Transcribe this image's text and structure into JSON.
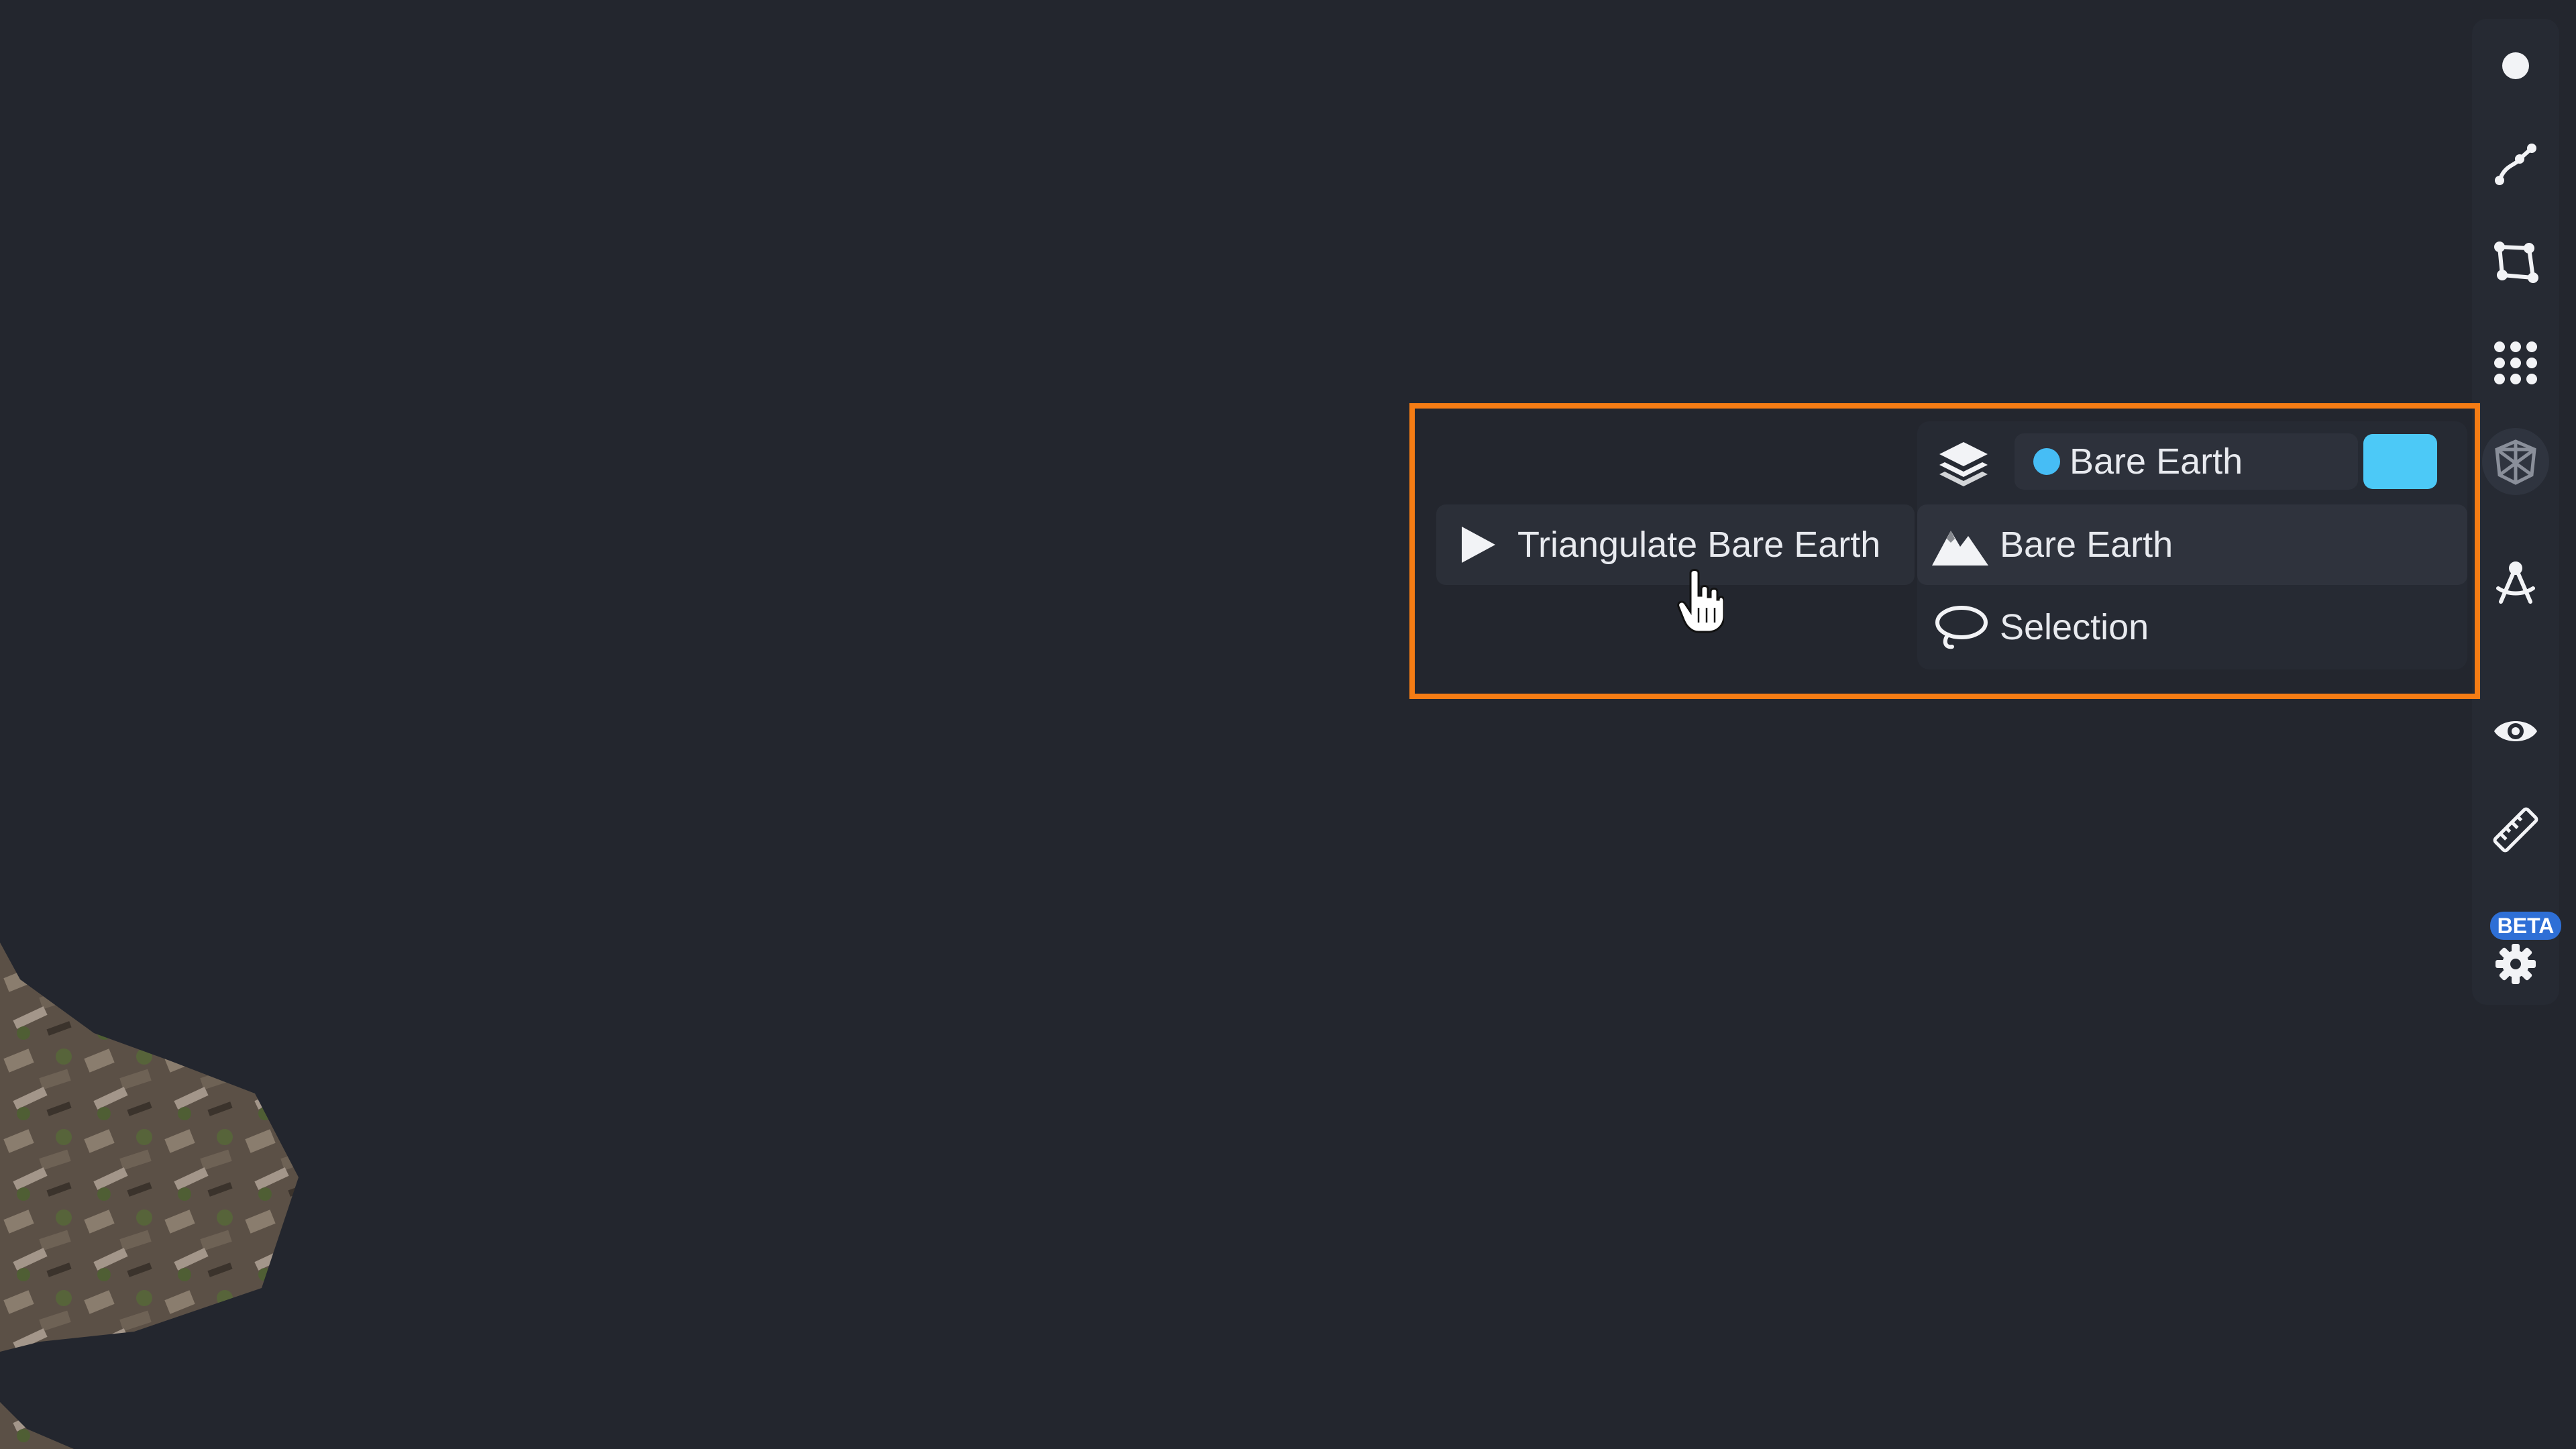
{
  "toolbar": {
    "items": [
      {
        "icon": "point-icon"
      },
      {
        "icon": "polyline-icon"
      },
      {
        "icon": "polygon-icon"
      },
      {
        "icon": "grid-dots-icon"
      },
      {
        "icon": "mesh-icon",
        "active": true
      },
      {
        "icon": "compass-icon"
      },
      {
        "icon": "eye-icon"
      },
      {
        "icon": "ruler-icon"
      },
      {
        "icon": "settings-gear-icon"
      }
    ],
    "beta_badge": "BETA"
  },
  "layer_panel": {
    "icon": "layers-icon",
    "selected_layer": {
      "label": "Bare Earth",
      "dot_color": "#46bdf5"
    },
    "color_swatch": "#4cc9f7",
    "menu": [
      {
        "icon": "mountain-icon",
        "label": "Bare Earth",
        "hover": true
      },
      {
        "icon": "lasso-icon",
        "label": "Selection"
      }
    ]
  },
  "action": {
    "icon": "play-icon",
    "label": "Triangulate Bare Earth"
  },
  "highlight_color": "#f57c14",
  "cursor": "hand-pointer-icon"
}
